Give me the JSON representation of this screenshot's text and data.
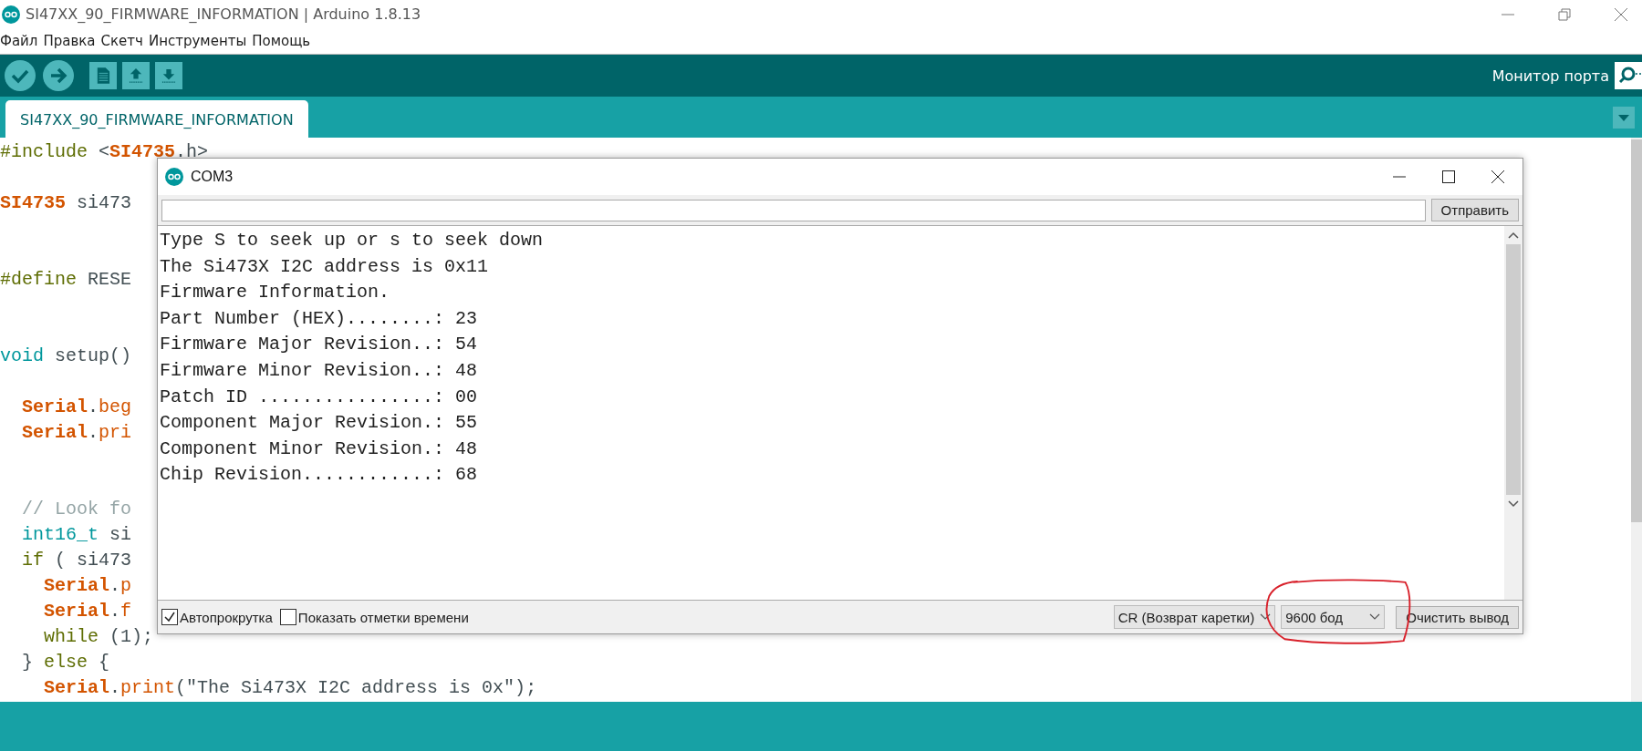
{
  "window": {
    "title": "SI47XX_90_FIRMWARE_INFORMATION | Arduino 1.8.13"
  },
  "menu": [
    "Файл",
    "Правка",
    "Скетч",
    "Инструменты",
    "Помощь"
  ],
  "toolbar": {
    "serial_monitor_label": "Монитор порта"
  },
  "tabs": [
    {
      "label": "SI47XX_90_FIRMWARE_INFORMATION",
      "selected": true
    }
  ],
  "editor": {
    "lines": [
      {
        "kind": "code",
        "segments": [
          {
            "kind": "directive",
            "text": "#include"
          },
          {
            "kind": "plain",
            "text": " <"
          },
          {
            "kind": "class",
            "text": "SI4735"
          },
          {
            "kind": "plain",
            "text": ".h>"
          }
        ]
      },
      {
        "kind": "blank"
      },
      {
        "kind": "code",
        "segments": [
          {
            "kind": "class",
            "text": "SI4735"
          },
          {
            "kind": "plain",
            "text": " si473"
          }
        ]
      },
      {
        "kind": "blank"
      },
      {
        "kind": "blank"
      },
      {
        "kind": "code",
        "segments": [
          {
            "kind": "directive",
            "text": "#define"
          },
          {
            "kind": "plain",
            "text": " RESE"
          }
        ]
      },
      {
        "kind": "blank"
      },
      {
        "kind": "blank"
      },
      {
        "kind": "code",
        "segments": [
          {
            "kind": "type",
            "text": "void"
          },
          {
            "kind": "plain",
            "text": " setup()"
          }
        ]
      },
      {
        "kind": "blank"
      },
      {
        "kind": "code",
        "segments": [
          {
            "kind": "class",
            "text": "  Serial"
          },
          {
            "kind": "plain",
            "text": "."
          },
          {
            "kind": "func",
            "text": "beg"
          }
        ]
      },
      {
        "kind": "code",
        "segments": [
          {
            "kind": "class",
            "text": "  Serial"
          },
          {
            "kind": "plain",
            "text": "."
          },
          {
            "kind": "func",
            "text": "pri"
          }
        ]
      },
      {
        "kind": "blank"
      },
      {
        "kind": "blank"
      },
      {
        "kind": "code",
        "segments": [
          {
            "kind": "comment",
            "text": "  // Look fo"
          }
        ]
      },
      {
        "kind": "code",
        "segments": [
          {
            "kind": "type",
            "text": "  int16_t"
          },
          {
            "kind": "plain",
            "text": " si"
          }
        ]
      },
      {
        "kind": "code",
        "segments": [
          {
            "kind": "control",
            "text": "  if"
          },
          {
            "kind": "plain",
            "text": " ( si473"
          }
        ]
      },
      {
        "kind": "code",
        "segments": [
          {
            "kind": "class",
            "text": "    Serial"
          },
          {
            "kind": "plain",
            "text": "."
          },
          {
            "kind": "func",
            "text": "p"
          }
        ]
      },
      {
        "kind": "code",
        "segments": [
          {
            "kind": "class",
            "text": "    Serial"
          },
          {
            "kind": "plain",
            "text": "."
          },
          {
            "kind": "func",
            "text": "f"
          }
        ]
      },
      {
        "kind": "code",
        "segments": [
          {
            "kind": "control",
            "text": "    while"
          },
          {
            "kind": "plain",
            "text": " (1);"
          }
        ]
      },
      {
        "kind": "code",
        "segments": [
          {
            "kind": "plain",
            "text": "  } "
          },
          {
            "kind": "control",
            "text": "else"
          },
          {
            "kind": "plain",
            "text": " {"
          }
        ]
      },
      {
        "kind": "code",
        "segments": [
          {
            "kind": "class",
            "text": "    Serial"
          },
          {
            "kind": "plain",
            "text": "."
          },
          {
            "kind": "func",
            "text": "print"
          },
          {
            "kind": "plain",
            "text": "(\"The Si473X I2C address is 0x\");"
          }
        ]
      }
    ]
  },
  "serial_monitor": {
    "title": "COM3",
    "send_button": "Отправить",
    "output": [
      "Type S to seek up or s to seek down",
      "The Si473X I2C address is 0x11",
      "Firmware Information.",
      "Part Number (HEX)........: 23",
      "Firmware Major Revision..: 54",
      "Firmware Minor Revision..: 48",
      "Patch ID ................: 00",
      "Component Major Revision.: 55",
      "Component Minor Revision.: 48",
      "Chip Revision............: 68"
    ],
    "options": [
      {
        "label": "Автопрокрутка",
        "checked": true
      },
      {
        "label": "Показать отметки времени",
        "checked": false
      }
    ],
    "line_ending": "CR (Возврат каретки)",
    "baud_rate": "9600 бод",
    "clear_button": "Очистить вывод"
  }
}
